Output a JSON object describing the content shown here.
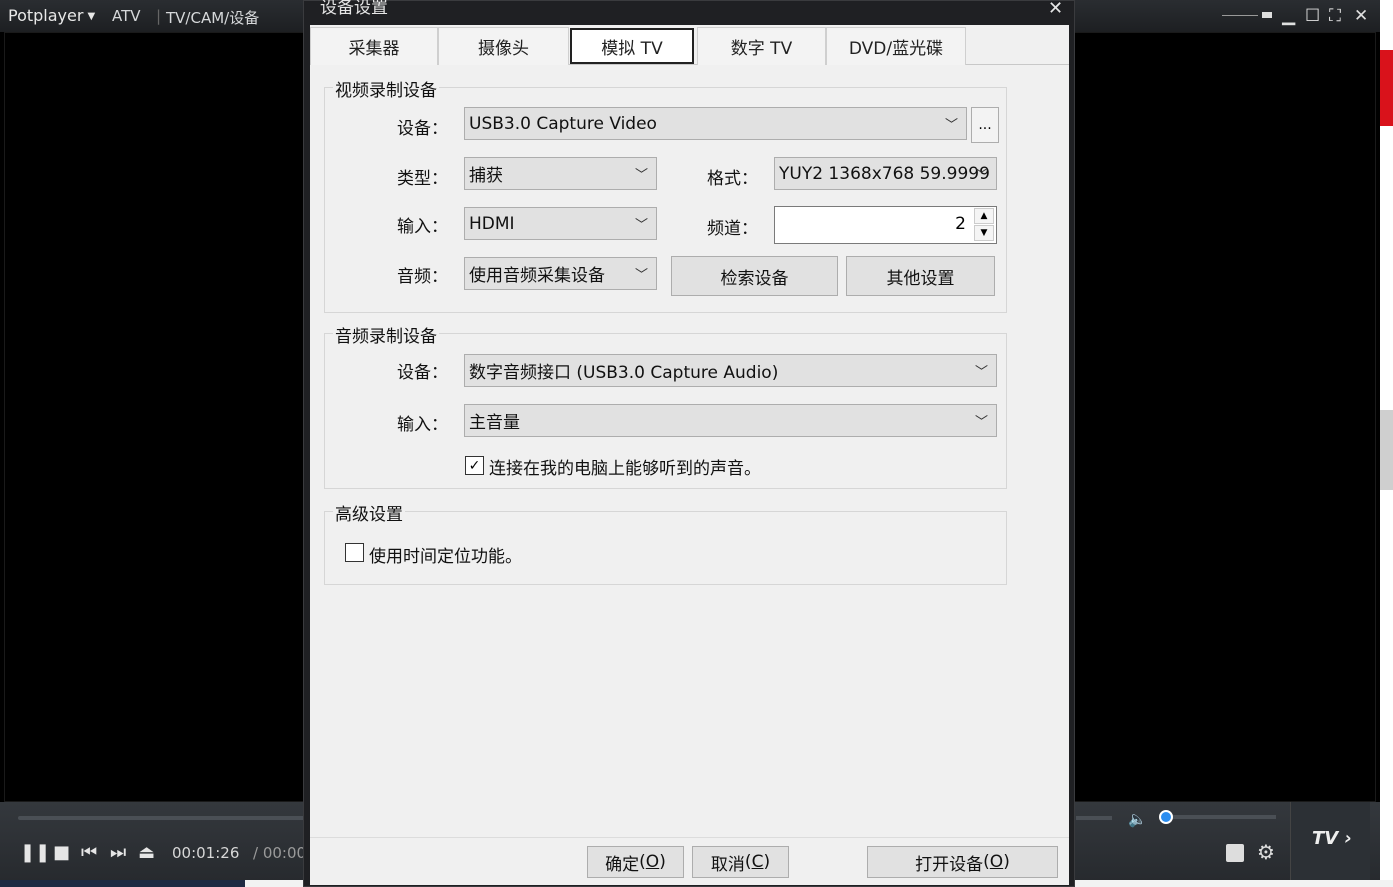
{
  "player": {
    "logo": "Potplayer",
    "tabs": [
      "ATV",
      "TV/CAM/设备"
    ],
    "time_current": "00:01:26",
    "time_total": "/ 00:00:",
    "tv_label": "TV",
    "window_controls": [
      "minimize",
      "maximize",
      "fullscreen",
      "close"
    ]
  },
  "dialog": {
    "title": "设备设置",
    "tabs": [
      "采集器",
      "摄像头",
      "模拟 TV",
      "数字 TV",
      "DVD/蓝光碟"
    ],
    "active_tab": "模拟 TV",
    "video_group": {
      "title": "视频录制设备",
      "device_label": "设备：",
      "device_value": "USB3.0 Capture Video",
      "more_button": "...",
      "type_label": "类型：",
      "type_value": "捕获",
      "format_label": "格式：",
      "format_value": "YUY2 1368x768 59.9999",
      "input_label": "输入：",
      "input_value": "HDMI",
      "channel_label": "频道：",
      "channel_value": "2",
      "audio_label": "音频：",
      "audio_value": "使用音频采集设备",
      "search_button": "检索设备",
      "other_button": "其他设置"
    },
    "audio_group": {
      "title": "音频录制设备",
      "device_label": "设备：",
      "device_value": "数字音频接口 (USB3.0 Capture Audio)",
      "input_label": "输入：",
      "input_value": "主音量",
      "listen_checkbox_label": "连接在我的电脑上能够听到的声音。",
      "listen_checked": true
    },
    "advanced_group": {
      "title": "高级设置",
      "timeshift_label": "使用时间定位功能。",
      "timeshift_checked": false
    },
    "footer": {
      "ok_text": "确定",
      "ok_key": "O",
      "cancel_text": "取消",
      "cancel_key": "C",
      "open_text": "打开设备",
      "open_key": "O"
    }
  }
}
